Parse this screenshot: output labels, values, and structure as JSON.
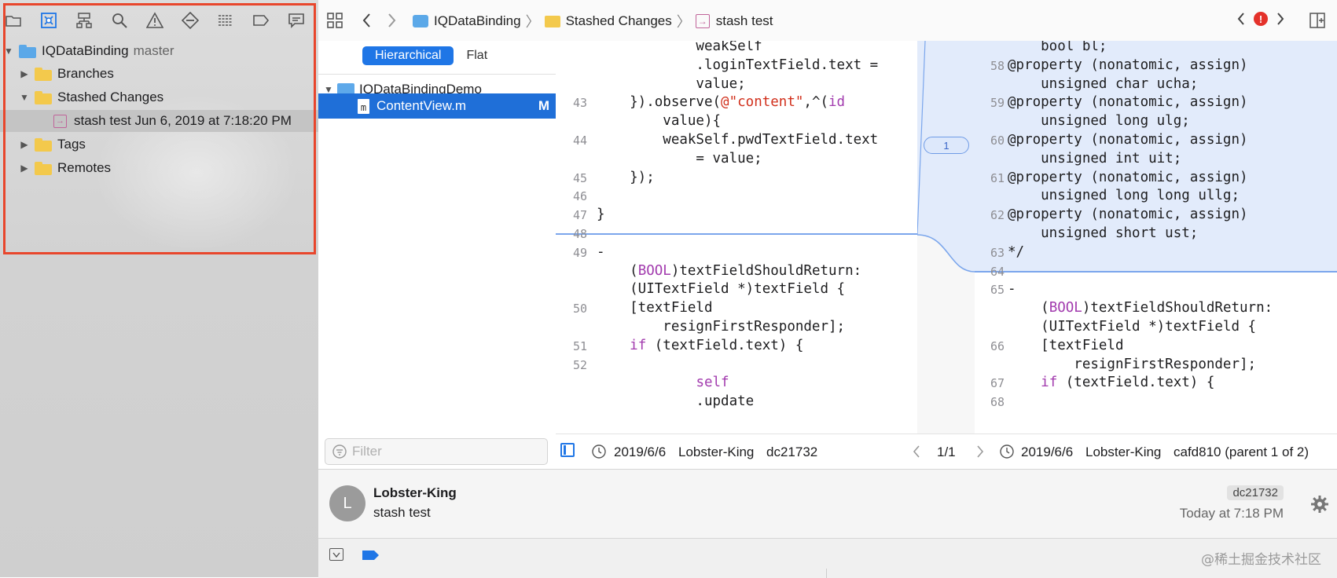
{
  "navigator": {
    "icons": [
      "folder-icon",
      "source-control-icon",
      "hierarchy-icon",
      "search-icon",
      "warning-icon",
      "test-icon",
      "debug-icon",
      "breakpoint-icon",
      "report-icon"
    ],
    "tree": [
      {
        "label": "IQDataBinding",
        "sub": "master",
        "level": 0,
        "expanded": true,
        "kind": "repo"
      },
      {
        "label": "Branches",
        "level": 1,
        "expanded": false,
        "kind": "folder"
      },
      {
        "label": "Stashed Changes",
        "level": 1,
        "expanded": true,
        "kind": "folder"
      },
      {
        "label": "stash test Jun 6, 2019 at 7:18:20 PM",
        "level": 2,
        "kind": "stash",
        "selected": true
      },
      {
        "label": "Tags",
        "level": 1,
        "expanded": false,
        "kind": "folder"
      },
      {
        "label": "Remotes",
        "level": 1,
        "expanded": false,
        "kind": "folder"
      }
    ]
  },
  "toolbar": {
    "breadcrumb": [
      "IQDataBinding",
      "Stashed Changes",
      "stash test"
    ]
  },
  "files": {
    "segments": [
      "Hierarchical",
      "Flat"
    ],
    "folder": "IQDataBindingDemo",
    "file": "ContentView.m",
    "file_status": "M",
    "filter_placeholder": "Filter"
  },
  "diff": {
    "change_count": "1",
    "left_lines": [
      {
        "n": "",
        "code": "            weakSelf"
      },
      {
        "n": "",
        "code": "            .loginTextField.text ="
      },
      {
        "n": "",
        "code": "            value;"
      },
      {
        "n": "43",
        "code": "    }).observe(@\"content\",^(id"
      },
      {
        "n": "",
        "code": "        value){"
      },
      {
        "n": "44",
        "code": "        weakSelf.pwdTextField.text"
      },
      {
        "n": "",
        "code": "            = value;"
      },
      {
        "n": "45",
        "code": "    });"
      },
      {
        "n": "46",
        "code": ""
      },
      {
        "n": "47",
        "code": "}"
      },
      {
        "n": "48",
        "code": ""
      },
      {
        "n": "49",
        "code": "-"
      },
      {
        "n": "",
        "code": "    (BOOL)textFieldShouldReturn:"
      },
      {
        "n": "",
        "code": "    (UITextField *)textField {"
      },
      {
        "n": "50",
        "code": "    [textField"
      },
      {
        "n": "",
        "code": "        resignFirstResponder];"
      },
      {
        "n": "51",
        "code": "    if (textField.text) {"
      },
      {
        "n": "52",
        "code": ""
      },
      {
        "n": "",
        "code": "            self"
      },
      {
        "n": "",
        "code": "            .update"
      }
    ],
    "right_lines": [
      {
        "n": "",
        "code": "    bool bl;"
      },
      {
        "n": "58",
        "code": "@property (nonatomic, assign)"
      },
      {
        "n": "",
        "code": "    unsigned char ucha;"
      },
      {
        "n": "59",
        "code": "@property (nonatomic, assign)"
      },
      {
        "n": "",
        "code": "    unsigned long ulg;"
      },
      {
        "n": "60",
        "code": "@property (nonatomic, assign)"
      },
      {
        "n": "",
        "code": "    unsigned int uit;"
      },
      {
        "n": "61",
        "code": "@property (nonatomic, assign)"
      },
      {
        "n": "",
        "code": "    unsigned long long ullg;"
      },
      {
        "n": "62",
        "code": "@property (nonatomic, assign)"
      },
      {
        "n": "",
        "code": "    unsigned short ust;"
      },
      {
        "n": "63",
        "code": "*/"
      },
      {
        "n": "64",
        "code": ""
      },
      {
        "n": "65",
        "code": "-"
      },
      {
        "n": "",
        "code": "    (BOOL)textFieldShouldReturn:"
      },
      {
        "n": "",
        "code": "    (UITextField *)textField {"
      },
      {
        "n": "66",
        "code": "    [textField"
      },
      {
        "n": "",
        "code": "        resignFirstResponder];"
      },
      {
        "n": "67",
        "code": "    if (textField.text) {"
      },
      {
        "n": "68",
        "code": ""
      }
    ]
  },
  "status": {
    "left_date": "2019/6/6",
    "left_author": "Lobster-King",
    "left_hash": "dc21732",
    "page": "1/1",
    "right_date": "2019/6/6",
    "right_author": "Lobster-King",
    "right_hash": "cafd810 (parent 1 of 2)"
  },
  "commit": {
    "avatar_letter": "L",
    "author": "Lobster-King",
    "message": "stash test",
    "hash": "dc21732",
    "time": "Today at 7:18 PM"
  },
  "watermark": "@稀土掘金技术社区",
  "colors": {
    "accent": "#1f76e6",
    "highlight_box": "#e8462c",
    "keyword": "#a23bae",
    "string": "#d12f1b",
    "diff_bg": "#e2ebfb"
  }
}
